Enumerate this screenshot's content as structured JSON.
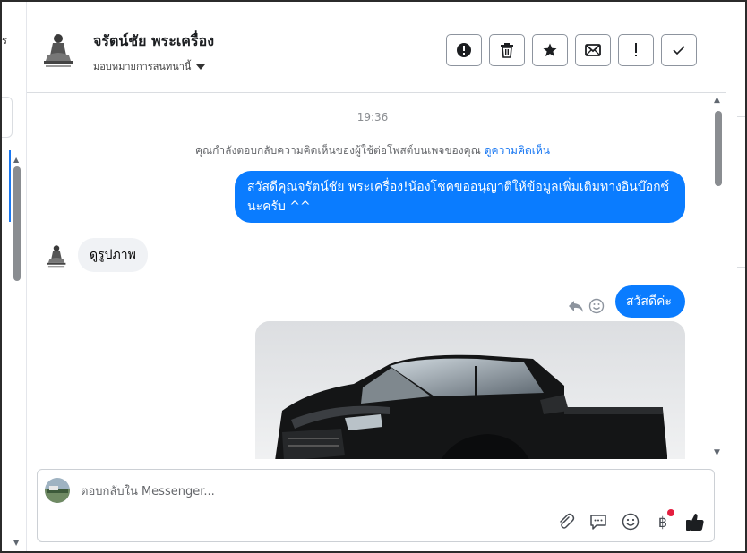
{
  "left_panel": {
    "fragment_text": "ร"
  },
  "header": {
    "contact_name": "จรัตน์ชัย พระเครื่อง",
    "assign_label": "มอบหมายการสนทนานี้",
    "actions": [
      {
        "name": "report",
        "icon": "alert-circle-icon"
      },
      {
        "name": "delete",
        "icon": "trash-icon"
      },
      {
        "name": "star",
        "icon": "star-icon"
      },
      {
        "name": "mark-unread",
        "icon": "envelope-icon"
      },
      {
        "name": "important",
        "icon": "exclamation-icon"
      },
      {
        "name": "done",
        "icon": "checkmark-icon"
      }
    ]
  },
  "conversation": {
    "timestamp": "19:36",
    "context_text": "คุณกำลังตอบกลับความคิดเห็นของผู้ใช้ต่อโพสต์บนเพจของคุณ",
    "context_link": "ดูความคิดเห็น",
    "messages": [
      {
        "direction": "outgoing",
        "text": "สวัสดีคุณจรัตน์ชัย พระเครื่อง!น้องโชคขออนุญาติให้ข้อมูลเพิ่มเติมทางอินบ๊อกซ์นะครับ ^^"
      },
      {
        "direction": "incoming",
        "text": "ดูรูปภาพ"
      },
      {
        "direction": "outgoing",
        "text": "สวัสดีค่ะ"
      },
      {
        "direction": "outgoing",
        "type": "image",
        "subject": "black-pickup-truck-photo"
      }
    ]
  },
  "composer": {
    "placeholder": "ตอบกลับใน Messenger...",
    "tools": [
      "paperclip-icon",
      "chat-bubble-icon",
      "smiley-icon",
      "baht-icon",
      "thumbs-up-icon"
    ],
    "baht_symbol": "฿"
  },
  "colors": {
    "accent": "#0a7cff",
    "link": "#1877f2",
    "incoming_bubble": "#f0f2f5",
    "notification_dot": "#e41e3f"
  }
}
